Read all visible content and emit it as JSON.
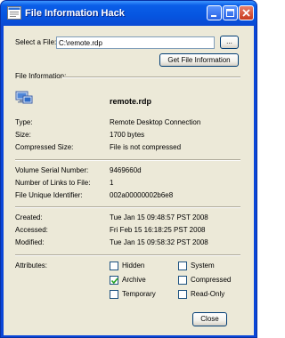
{
  "window": {
    "title": "File Information Hack",
    "controls": {
      "minimize": "minimize",
      "maximize": "maximize",
      "close": "close"
    }
  },
  "file_select": {
    "label": "Select a File:",
    "path_value": "C:\\remote.rdp",
    "browse_label": "...",
    "get_info_label": "Get File Information"
  },
  "info": {
    "section_label": "File Information:",
    "filename": "remote.rdp",
    "rows_basic": [
      {
        "label": "Type:",
        "value": "Remote Desktop Connection"
      },
      {
        "label": "Size:",
        "value": "1700 bytes"
      },
      {
        "label": "Compressed Size:",
        "value": "File is not compressed"
      }
    ],
    "rows_ids": [
      {
        "label": "Volume Serial Number:",
        "value": "9469660d"
      },
      {
        "label": "Number of Links to File:",
        "value": "1"
      },
      {
        "label": "File Unique Identifier:",
        "value": "002a00000002b6e8"
      }
    ],
    "rows_dates": [
      {
        "label": "Created:",
        "value": "Tue Jan 15 09:48:57 PST 2008"
      },
      {
        "label": "Accessed:",
        "value": "Fri Feb 15 16:18:25 PST 2008"
      },
      {
        "label": "Modified:",
        "value": "Tue Jan 15 09:58:32 PST 2008"
      }
    ]
  },
  "attributes": {
    "label": "Attributes:",
    "items": [
      {
        "name": "Hidden",
        "checked": false
      },
      {
        "name": "System",
        "checked": false
      },
      {
        "name": "Archive",
        "checked": true
      },
      {
        "name": "Compressed",
        "checked": false
      },
      {
        "name": "Temporary",
        "checked": false
      },
      {
        "name": "Read-Only",
        "checked": false
      }
    ]
  },
  "footer": {
    "close_label": "Close"
  },
  "colors": {
    "title_bar": "#0a5ee8",
    "client_bg": "#ece9d8",
    "close_button": "#c8391c",
    "checkmark": "#21a121"
  }
}
